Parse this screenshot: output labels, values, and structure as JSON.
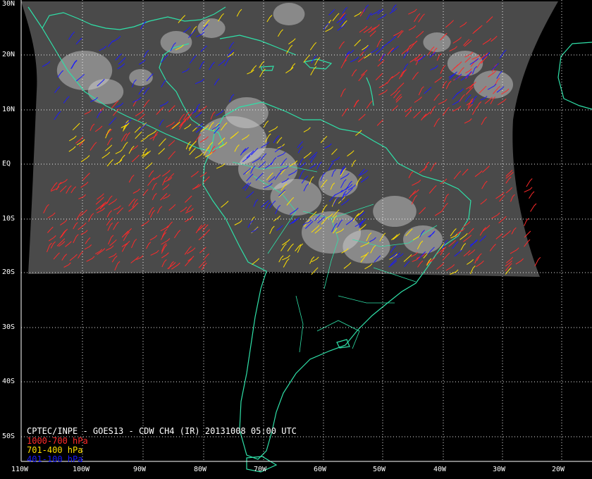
{
  "title": "CPTEC/INPE - GOES13 - CDW CH4 (IR) 20131008 05:00 UTC",
  "latitude_labels": [
    "30N",
    "20N",
    "10N",
    "EQ",
    "10S",
    "20S",
    "30S",
    "40S",
    "50S"
  ],
  "longitude_labels": [
    "110W",
    "100W",
    "90W",
    "80W",
    "70W",
    "60W",
    "50W",
    "40W",
    "30W",
    "20W"
  ],
  "legend": [
    {
      "label": "1000-700 hPa",
      "color": "#ff2a2a"
    },
    {
      "label": "701-400 hPa",
      "color": "#ffe000"
    },
    {
      "label": "401-100 hPa",
      "color": "#1a1aff"
    }
  ],
  "colors": {
    "background": "#000000",
    "coastline": "#2fe0a8",
    "grid": "#ffffff",
    "ir_imagery": "#4a4a4a",
    "cloud": "#d8d8d8"
  }
}
